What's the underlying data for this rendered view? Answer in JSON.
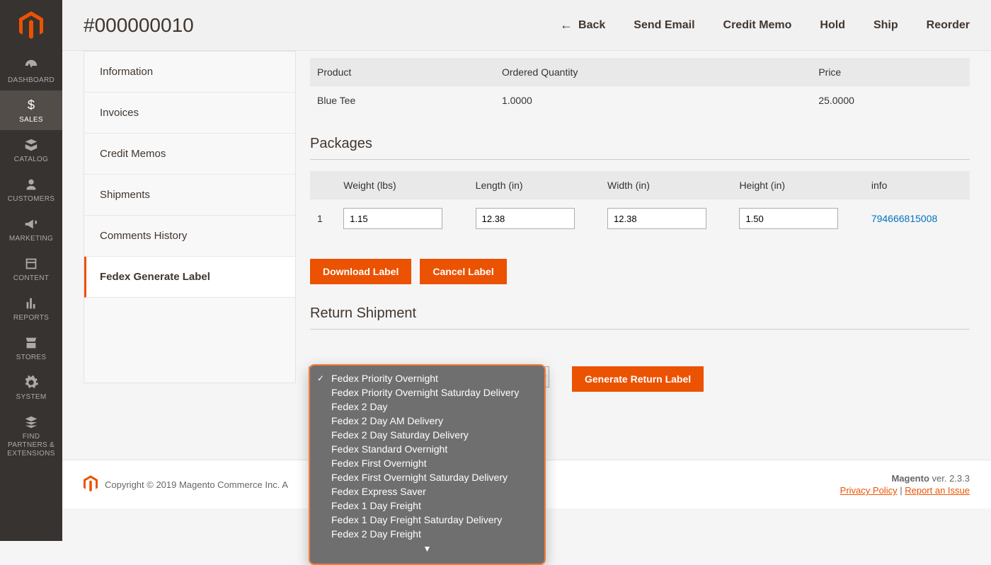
{
  "header": {
    "title": "#000000010",
    "actions": {
      "back": "Back",
      "send_email": "Send Email",
      "credit_memo": "Credit Memo",
      "hold": "Hold",
      "ship": "Ship",
      "reorder": "Reorder"
    }
  },
  "sidebar": {
    "items": [
      {
        "key": "dashboard",
        "label": "DASHBOARD"
      },
      {
        "key": "sales",
        "label": "SALES"
      },
      {
        "key": "catalog",
        "label": "CATALOG"
      },
      {
        "key": "customers",
        "label": "CUSTOMERS"
      },
      {
        "key": "marketing",
        "label": "MARKETING"
      },
      {
        "key": "content",
        "label": "CONTENT"
      },
      {
        "key": "reports",
        "label": "REPORTS"
      },
      {
        "key": "stores",
        "label": "STORES"
      },
      {
        "key": "system",
        "label": "SYSTEM"
      },
      {
        "key": "partners",
        "label": "FIND PARTNERS & EXTENSIONS"
      }
    ]
  },
  "tabs": [
    "Information",
    "Invoices",
    "Credit Memos",
    "Shipments",
    "Comments History",
    "Fedex Generate Label"
  ],
  "products_table": {
    "headers": {
      "product": "Product",
      "qty": "Ordered Quantity",
      "price": "Price"
    },
    "rows": [
      {
        "product": "Blue Tee",
        "qty": "1.0000",
        "price": "25.0000"
      }
    ]
  },
  "packages": {
    "title": "Packages",
    "headers": {
      "idx": "",
      "weight": "Weight (lbs)",
      "length": "Length (in)",
      "width": "Width (in)",
      "height": "Height (in)",
      "info": "info"
    },
    "rows": [
      {
        "idx": "1",
        "weight": "1.15",
        "length": "12.38",
        "width": "12.38",
        "height": "1.50",
        "info": "794666815008"
      }
    ],
    "download_label": "Download Label",
    "cancel_label": "Cancel Label"
  },
  "return_shipment": {
    "title": "Return Shipment",
    "generate_return_label": "Generate Return Label",
    "options": [
      "Fedex Priority Overnight",
      "Fedex Priority Overnight Saturday Delivery",
      "Fedex 2 Day",
      "Fedex 2 Day AM Delivery",
      "Fedex 2 Day Saturday Delivery",
      "Fedex Standard Overnight",
      "Fedex First Overnight",
      "Fedex First Overnight Saturday Delivery",
      "Fedex Express Saver",
      "Fedex 1 Day Freight",
      "Fedex 1 Day Freight Saturday Delivery",
      "Fedex 2 Day Freight"
    ],
    "selected_index": 0
  },
  "footer": {
    "copyright": "Copyright © 2019 Magento Commerce Inc. A",
    "brand": "Magento",
    "version_label": "ver. 2.3.3",
    "privacy": "Privacy Policy",
    "report": "Report an Issue",
    "sep": " | "
  },
  "colors": {
    "accent": "#eb5202"
  }
}
